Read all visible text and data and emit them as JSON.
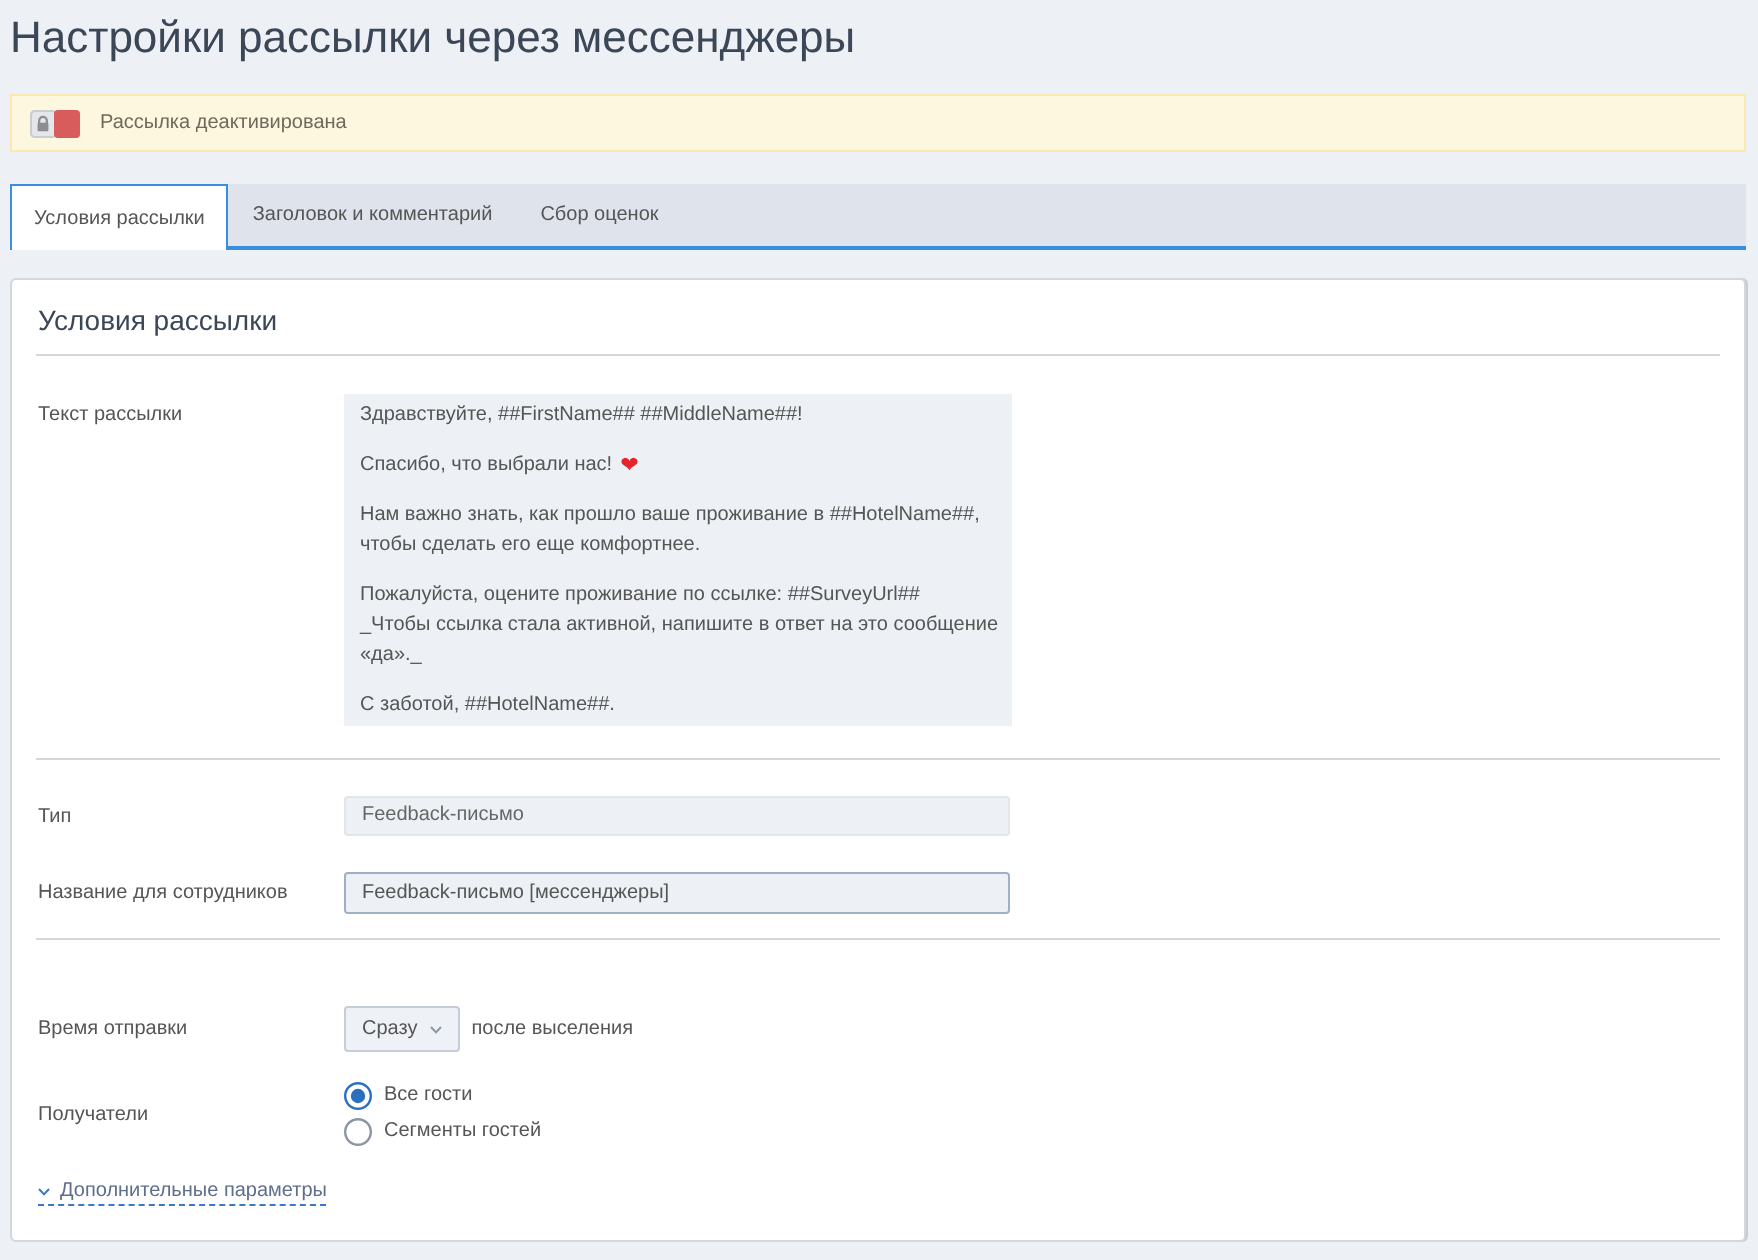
{
  "page": {
    "title": "Настройки рассылки через мессенджеры"
  },
  "alert": {
    "text": "Рассылка деактивирована",
    "switch_on": false
  },
  "tabs": [
    {
      "label": "Условия рассылки",
      "selected": true
    },
    {
      "label": "Заголовок и комментарий",
      "selected": false
    },
    {
      "label": "Сбор оценок",
      "selected": false
    }
  ],
  "panel": {
    "title": "Условия рассылки"
  },
  "message": {
    "label": "Текст рассылки",
    "paragraphs": [
      {
        "lines": [
          "Здравствуйте, ##FirstName## ##MiddleName##!"
        ]
      },
      {
        "lines": [
          "Спасибо, что выбрали нас!"
        ],
        "emoji": "❤"
      },
      {
        "lines": [
          "Нам важно знать, как прошло ваше проживание в ##HotelName##,",
          "чтобы сделать его еще комфортнее."
        ]
      },
      {
        "lines": [
          "Пожалуйста, оцените проживание по ссылке: ##SurveyUrl##",
          "_Чтобы ссылка стала активной, напишите в ответ на это сообщение",
          "«да»._"
        ]
      },
      {
        "lines": [
          "С заботой, ##HotelName##."
        ]
      }
    ]
  },
  "type_field": {
    "label": "Тип",
    "value": "Feedback-письмо",
    "disabled": true
  },
  "staff_name_field": {
    "label": "Название для сотрудников",
    "value": "Feedback-письмо [мессенджеры]",
    "disabled": false
  },
  "send_time": {
    "label": "Время отправки",
    "value": "Сразу",
    "suffix": "после выселения"
  },
  "recipients": {
    "label": "Получатели",
    "options": [
      {
        "label": "Все гости",
        "selected": true
      },
      {
        "label": "Сегменты гостей",
        "selected": false
      }
    ]
  },
  "more_link": {
    "label": "Дополнительные параметры",
    "expanded": false
  }
}
